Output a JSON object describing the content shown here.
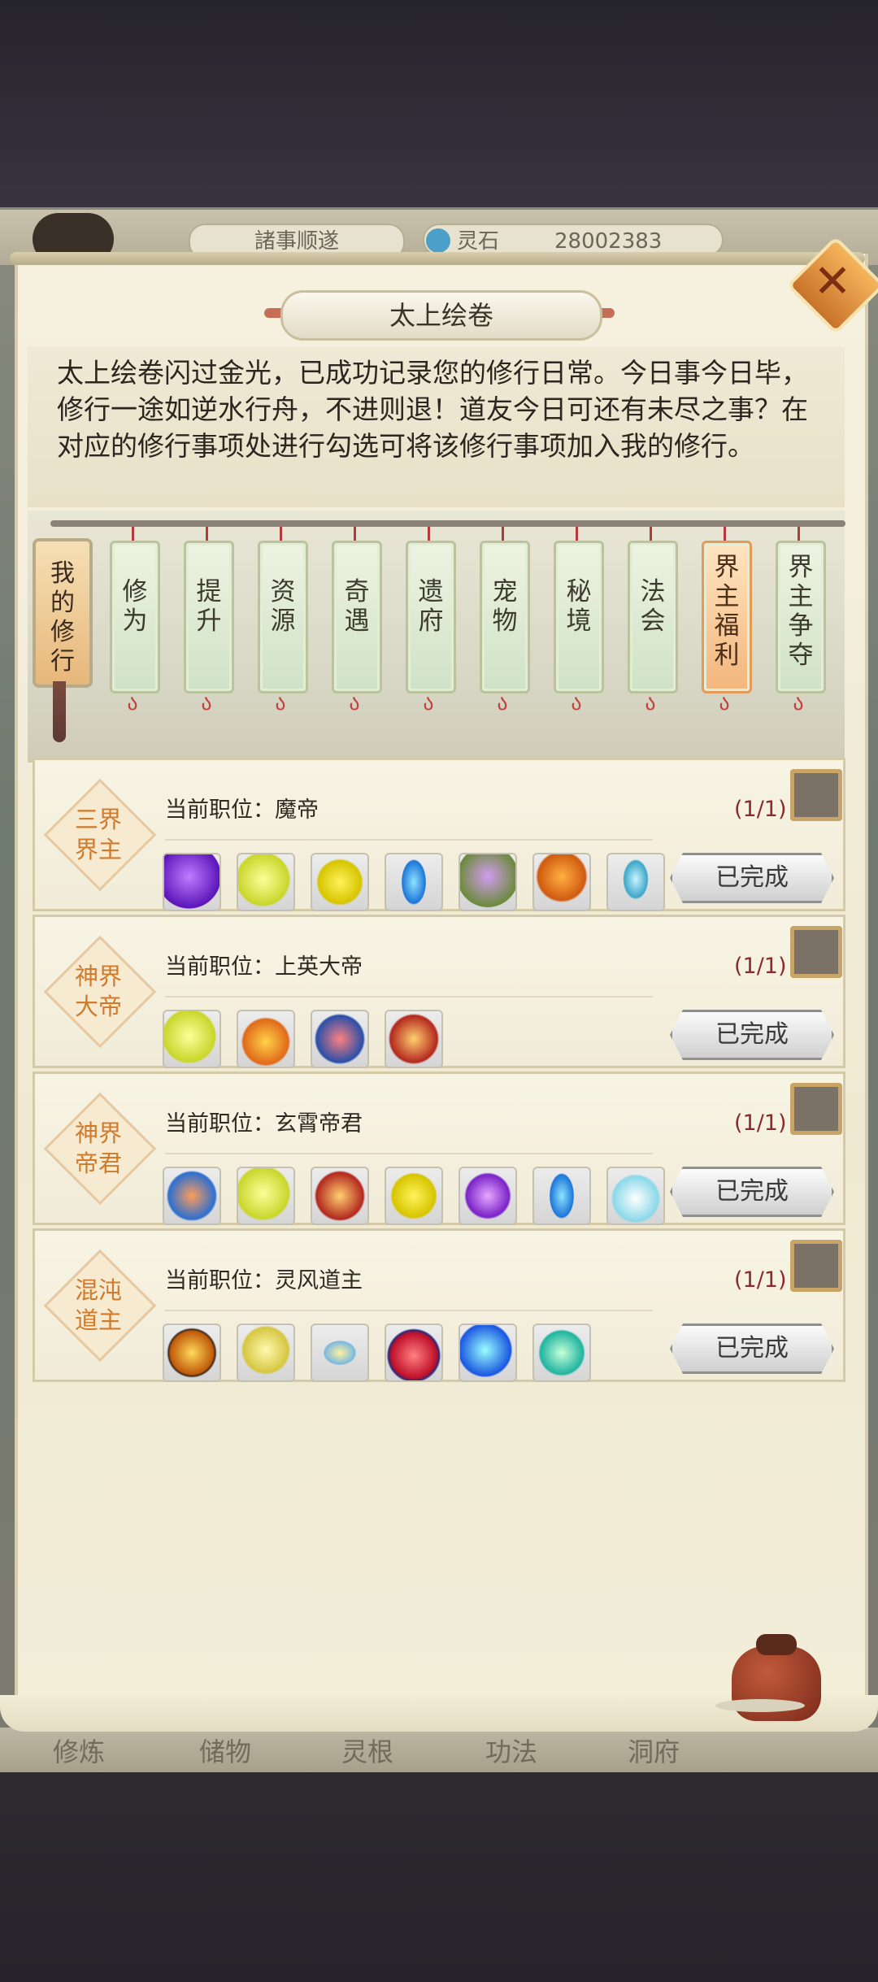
{
  "background": {
    "top_bar": {
      "status_text": "諸事顺遂",
      "currency_label": "灵石",
      "currency_value": "28002383"
    },
    "bottom_tabs": [
      "修炼",
      "储物",
      "灵根",
      "功法",
      "洞府"
    ]
  },
  "dialog": {
    "title": "太上绘卷",
    "description": "太上绘卷闪过金光，已成功记录您的修行日常。今日事今日毕，修行一途如逆水行舟，不进则退！道友今日可还有未尽之事？在对应的修行事项处进行勾选可将该修行事项加入我的修行。",
    "my_tab": {
      "label": "我的修行",
      "chars": [
        "我",
        "的",
        "修",
        "行"
      ]
    },
    "tabs": [
      {
        "label": "修为",
        "chars": [
          "修",
          "为"
        ],
        "active": false
      },
      {
        "label": "提升",
        "chars": [
          "提",
          "升"
        ],
        "active": false
      },
      {
        "label": "资源",
        "chars": [
          "资",
          "源"
        ],
        "active": false
      },
      {
        "label": "奇遇",
        "chars": [
          "奇",
          "遇"
        ],
        "active": false
      },
      {
        "label": "遗府",
        "chars": [
          "遗",
          "府"
        ],
        "active": false
      },
      {
        "label": "宠物",
        "chars": [
          "宠",
          "物"
        ],
        "active": false
      },
      {
        "label": "秘境",
        "chars": [
          "秘",
          "境"
        ],
        "active": false
      },
      {
        "label": "法会",
        "chars": [
          "法",
          "会"
        ],
        "active": false
      },
      {
        "label": "界主福利",
        "chars": [
          "界",
          "主",
          "福",
          "利"
        ],
        "active": true
      },
      {
        "label": "界主争夺",
        "chars": [
          "界",
          "主",
          "争",
          "夺"
        ],
        "active": false
      }
    ],
    "rows": [
      {
        "badge": [
          "三界",
          "界主"
        ],
        "position": "当前职位：魔帝",
        "count": "(1/1)",
        "button": "已完成",
        "items": [
          "purple-orb-item",
          "yellow-orb-item",
          "yellow-gem-item",
          "blue-crystal-item",
          "purple-flower-item",
          "orange-flower-item",
          "blue-flame-item"
        ]
      },
      {
        "badge": [
          "神界",
          "大帝"
        ],
        "position": "当前职位：上英大帝",
        "count": "(1/1)",
        "button": "已完成",
        "items": [
          "yellow-orb-item",
          "fire-pot-item",
          "blue-chest-item",
          "red-chest-item"
        ]
      },
      {
        "badge": [
          "神界",
          "帝君"
        ],
        "position": "当前职位：玄霄帝君",
        "count": "(1/1)",
        "button": "已完成",
        "items": [
          "blue-pouch-item",
          "yellow-orb-item",
          "red-chest-item",
          "yellow-gem-item",
          "purple-gem-item",
          "blue-crystal-item",
          "gourd-item"
        ]
      },
      {
        "badge": [
          "混沌",
          "道主"
        ],
        "position": "当前职位：灵风道主",
        "count": "(1/1)",
        "button": "已完成",
        "items": [
          "fire-bowl-item",
          "star-orb-item",
          "golden-feather-item",
          "red-flame-item",
          "blue-orb-item",
          "green-crystal-item"
        ]
      }
    ]
  }
}
